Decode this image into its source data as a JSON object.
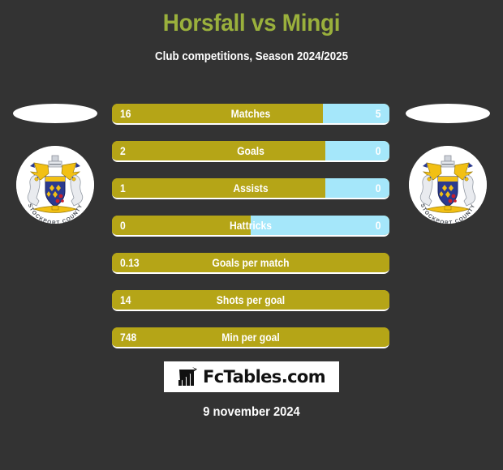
{
  "header": {
    "title": "Horsfall vs Mingi",
    "subtitle": "Club competitions, Season 2024/2025",
    "title_color": "#9AB03C"
  },
  "colors": {
    "background": "#333333",
    "home_bar": "#B5A517",
    "away_bar": "#A5E7FA",
    "text": "#ffffff"
  },
  "players": {
    "home": {
      "photo": "player-photo-placeholder",
      "badge": "club-crest-badge"
    },
    "away": {
      "photo": "player-photo-placeholder",
      "badge": "club-crest-badge"
    }
  },
  "chart_data": {
    "type": "bar",
    "title": "Horsfall vs Mingi",
    "subtitle": "Club competitions, Season 2024/2025",
    "categories": [
      "Matches",
      "Goals",
      "Assists",
      "Hattricks",
      "Goals per match",
      "Shots per goal",
      "Min per goal"
    ],
    "series": [
      {
        "name": "Horsfall",
        "color": "#B5A517",
        "values": [
          "16",
          "2",
          "1",
          "0",
          "0.13",
          "14",
          "748"
        ]
      },
      {
        "name": "Mingi",
        "color": "#A5E7FA",
        "values": [
          "5",
          "0",
          "0",
          "0",
          null,
          null,
          null
        ]
      }
    ],
    "legend": "none",
    "grid": false
  },
  "stats": [
    {
      "label": "Matches",
      "home": "16",
      "away": "5",
      "home_pct": 76,
      "split": true
    },
    {
      "label": "Goals",
      "home": "2",
      "away": "0",
      "home_pct": 77,
      "split": true
    },
    {
      "label": "Assists",
      "home": "1",
      "away": "0",
      "home_pct": 77,
      "split": true
    },
    {
      "label": "Hattricks",
      "home": "0",
      "away": "0",
      "home_pct": 50,
      "split": true
    },
    {
      "label": "Goals per match",
      "home": "0.13",
      "away": "",
      "home_pct": 100,
      "split": false
    },
    {
      "label": "Shots per goal",
      "home": "14",
      "away": "",
      "home_pct": 100,
      "split": false
    },
    {
      "label": "Min per goal",
      "home": "748",
      "away": "",
      "home_pct": 100,
      "split": false
    }
  ],
  "footer": {
    "logo_text": "FcTables.com",
    "logo_icon": "bar-chart-growth-icon",
    "date": "9 november 2024"
  }
}
